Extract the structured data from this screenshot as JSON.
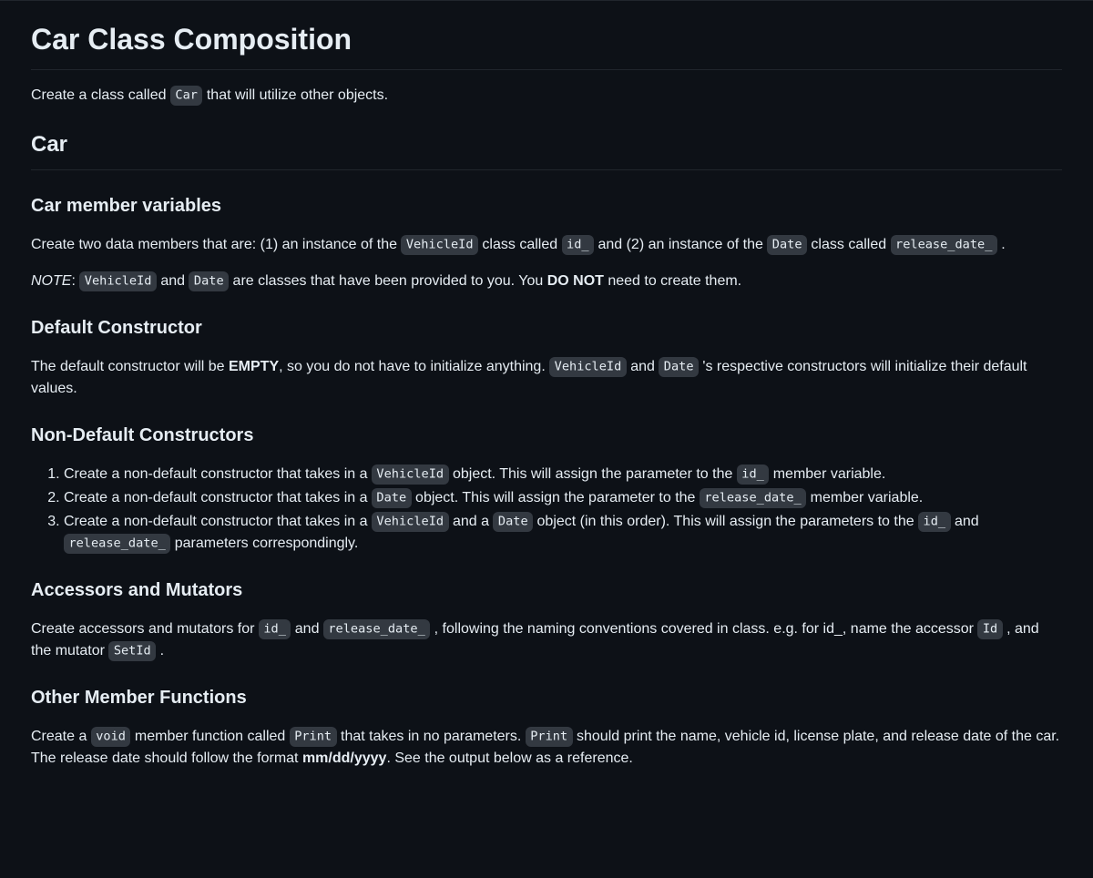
{
  "h1": "Car Class Composition",
  "intro": {
    "p1a": "Create a class called ",
    "code1": "Car",
    "p1b": " that will utilize other objects."
  },
  "h2_car": "Car",
  "member_vars": {
    "heading": "Car member variables",
    "p1_a": "Create two data members that are: (1) an instance of the ",
    "code1": "VehicleId",
    "p1_b": " class called ",
    "code2": "id_",
    "p1_c": " and (2) an instance of the ",
    "code3": "Date",
    "p1_d": " class called ",
    "code4": "release_date_",
    "p1_e": " .",
    "note_em": "NOTE",
    "note_a": ": ",
    "note_code1": "VehicleId",
    "note_b": " and ",
    "note_code2": "Date",
    "note_c": " are classes that have been provided to you. You ",
    "note_strong": "DO NOT",
    "note_d": " need to create them."
  },
  "default_ctor": {
    "heading": "Default Constructor",
    "p_a": "The default constructor will be ",
    "strong1": "EMPTY",
    "p_b": ", so you do not have to initialize anything. ",
    "code1": "VehicleId",
    "p_c": " and ",
    "code2": "Date",
    "p_d": " 's respective constructors will initialize their default values."
  },
  "non_default": {
    "heading": "Non-Default Constructors",
    "li1_a": "Create a non-default constructor that takes in a ",
    "li1_code1": "VehicleId",
    "li1_b": " object. This will assign the parameter to the ",
    "li1_code2": "id_",
    "li1_c": " member variable.",
    "li2_a": "Create a non-default constructor that takes in a ",
    "li2_code1": "Date",
    "li2_b": " object. This will assign the parameter to the ",
    "li2_code2": "release_date_",
    "li2_c": " member variable.",
    "li3_a": "Create a non-default constructor that takes in a ",
    "li3_code1": "VehicleId",
    "li3_b": " and a ",
    "li3_code2": "Date",
    "li3_c": " object (in this order). This will assign the parameters to the ",
    "li3_code3": "id_",
    "li3_d": " and ",
    "li3_code4": "release_date_",
    "li3_e": " parameters correspondingly."
  },
  "accessors": {
    "heading": "Accessors and Mutators",
    "p_a": "Create accessors and mutators for ",
    "code1": "id_",
    "p_b": " and ",
    "code2": "release_date_",
    "p_c": " , following the naming conventions covered in class. e.g. for id_, name the accessor ",
    "code3": "Id",
    "p_d": " , and the mutator ",
    "code4": "SetId",
    "p_e": " ."
  },
  "other": {
    "heading": "Other Member Functions",
    "p_a": "Create a ",
    "code1": "void",
    "p_b": " member function called ",
    "code2": "Print",
    "p_c": " that takes in no parameters. ",
    "code3": "Print",
    "p_d": " should print the name, vehicle id, license plate, and release date of the car. The release date should follow the format ",
    "strong1": "mm/dd/yyyy",
    "p_e": ". See the output below as a reference."
  }
}
